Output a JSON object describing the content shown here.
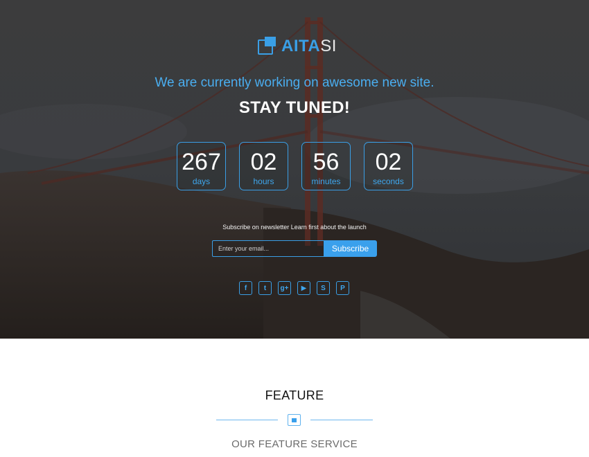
{
  "brand": {
    "logo_primary": "AITA",
    "logo_secondary": "SI"
  },
  "hero": {
    "tagline": "We are currently working on awesome new site.",
    "headline": "STAY TUNED!"
  },
  "countdown": [
    {
      "value": "267",
      "label": "days"
    },
    {
      "value": "02",
      "label": "hours"
    },
    {
      "value": "56",
      "label": "minutes"
    },
    {
      "value": "02",
      "label": "seconds"
    }
  ],
  "newsletter": {
    "text": "Subscribe on newsletter Learn first about the launch",
    "email_placeholder": "Enter your email...",
    "button_label": "Subscribe"
  },
  "social": [
    {
      "icon": "facebook-icon",
      "glyph": "f"
    },
    {
      "icon": "twitter-icon",
      "glyph": "t"
    },
    {
      "icon": "google-plus-icon",
      "glyph": "g+"
    },
    {
      "icon": "youtube-icon",
      "glyph": "▶"
    },
    {
      "icon": "skype-icon",
      "glyph": "S"
    },
    {
      "icon": "pinterest-icon",
      "glyph": "P"
    }
  ],
  "feature": {
    "title": "FEATURE",
    "subtitle": "OUR FEATURE SERVICE"
  },
  "colors": {
    "accent": "#3a9fe6",
    "hero_dark": "#2c2e31"
  }
}
